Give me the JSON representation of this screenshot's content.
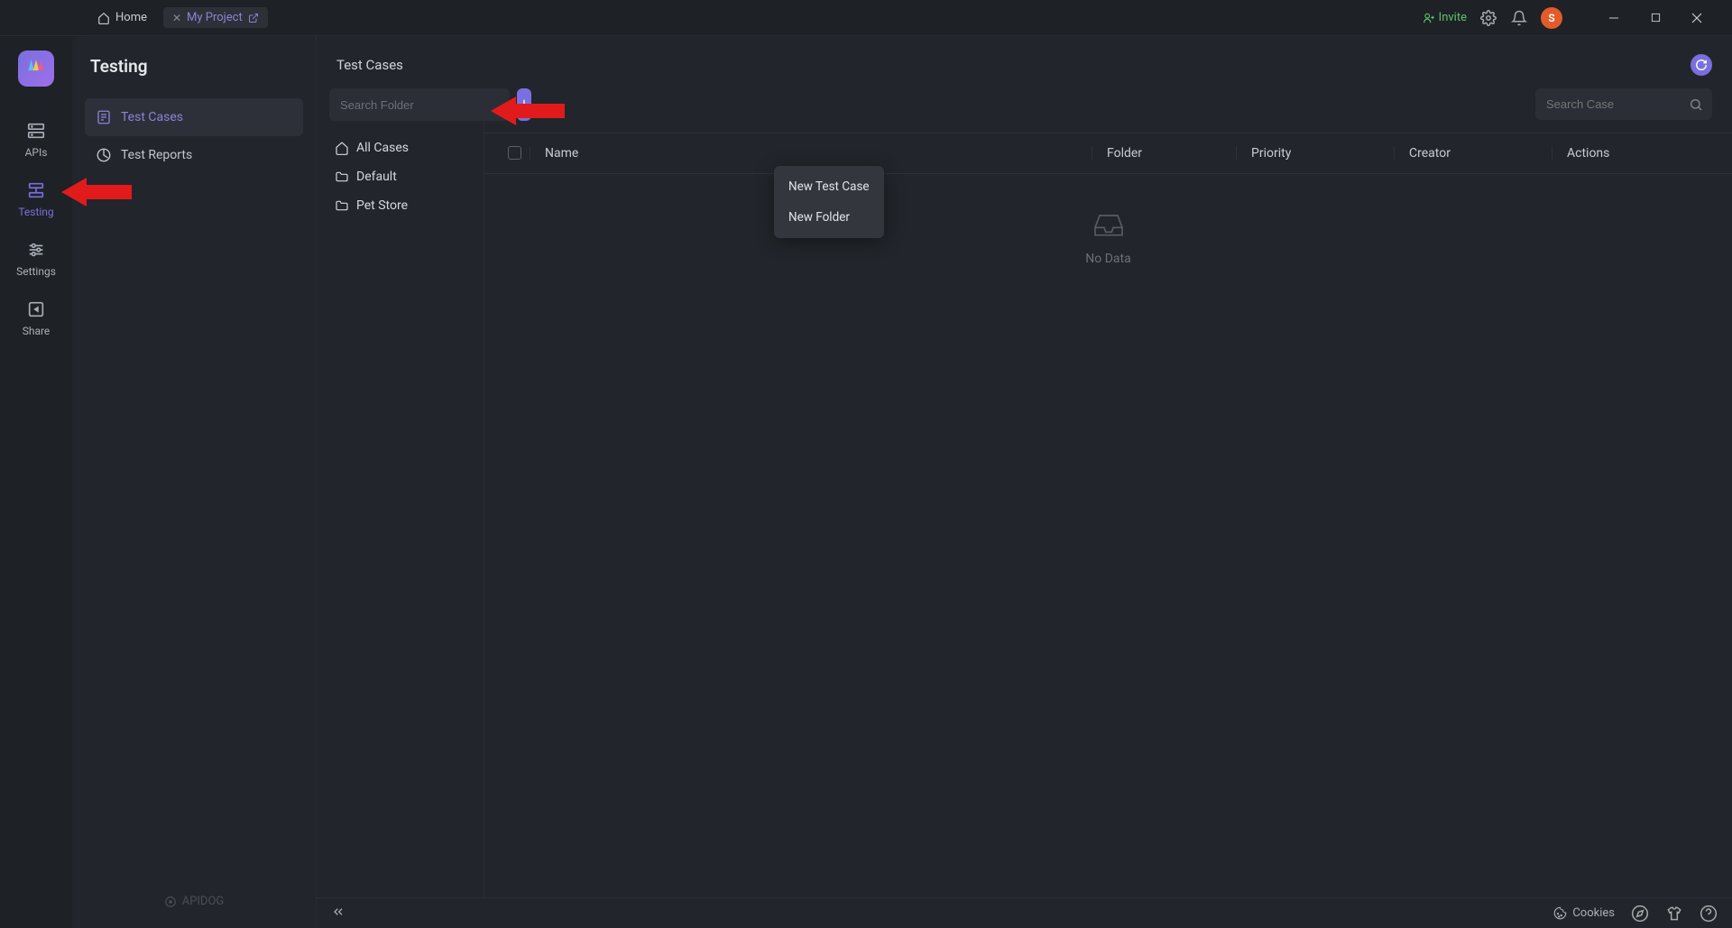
{
  "titlebar": {
    "home": "Home",
    "project_name": "My Project",
    "invite": "Invite",
    "avatar_initial": "S"
  },
  "rail": {
    "apis": "APIs",
    "testing": "Testing",
    "settings": "Settings",
    "share": "Share"
  },
  "sidebar": {
    "title": "Testing",
    "items": [
      {
        "label": "Test Cases"
      },
      {
        "label": "Test Reports"
      }
    ],
    "footer_brand": "APIDOG"
  },
  "content": {
    "page_title": "Test Cases",
    "search_folder_placeholder": "Search Folder",
    "folders": [
      {
        "label": "All Cases"
      },
      {
        "label": "Default"
      },
      {
        "label": "Pet Store"
      }
    ],
    "dropdown": {
      "new_test_case": "New Test Case",
      "new_folder": "New Folder"
    },
    "search_case_placeholder": "Search Case",
    "table": {
      "columns": {
        "name": "Name",
        "folder": "Folder",
        "priority": "Priority",
        "creator": "Creator",
        "actions": "Actions"
      },
      "empty": "No Data"
    }
  },
  "footer": {
    "cookies": "Cookies"
  }
}
